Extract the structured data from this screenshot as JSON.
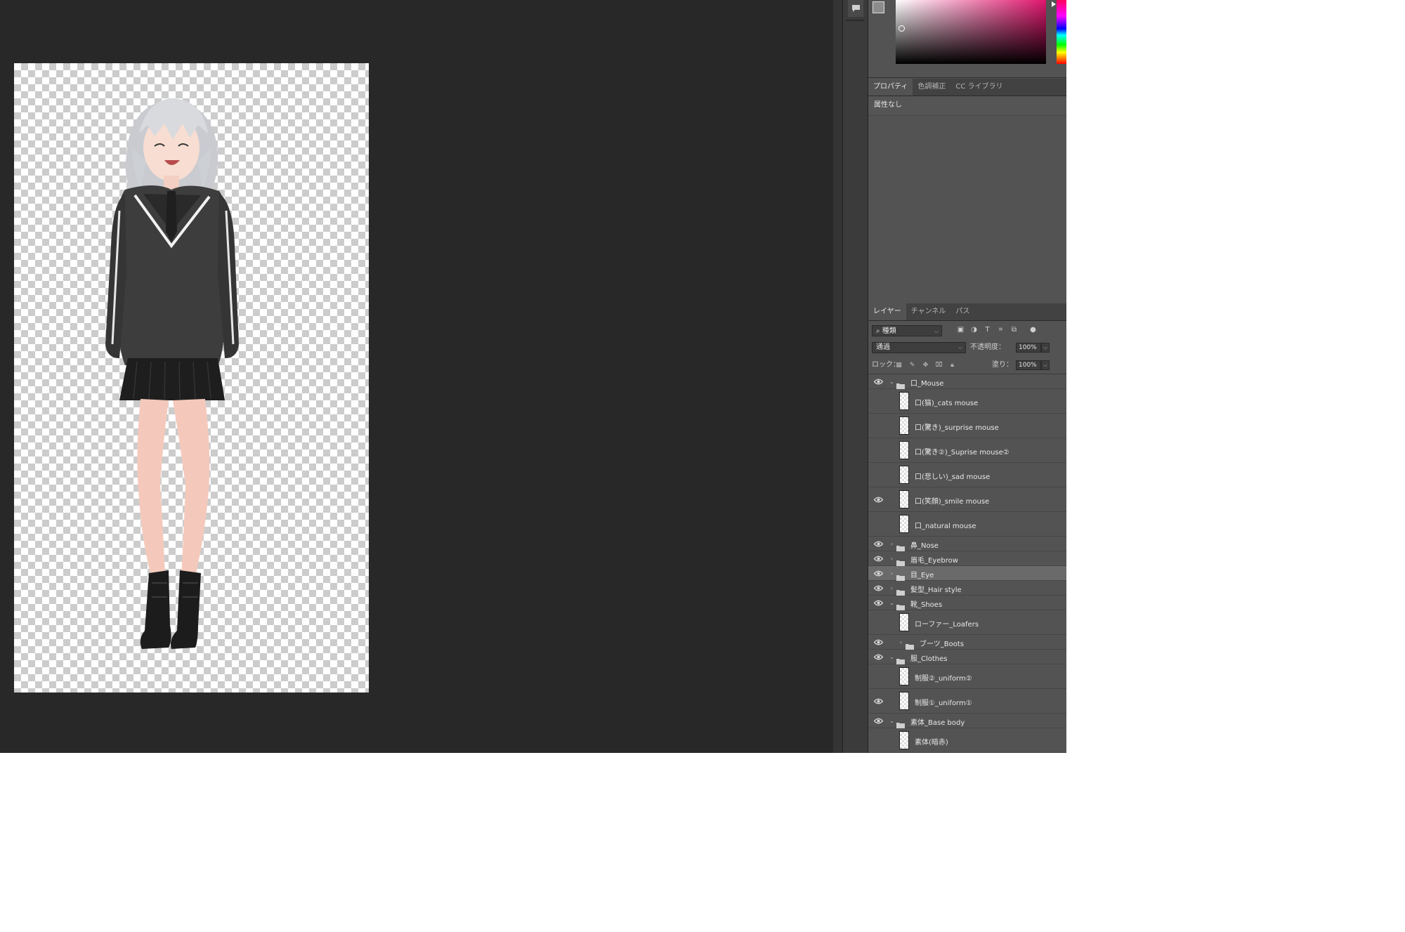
{
  "colors": {
    "workspace": "#282828",
    "panel": "#535353",
    "selected_layer": "#6a6a6a",
    "foreground_swatch": "#8b8b8b",
    "background_swatch": "#ffffff",
    "color_field_hue": "#e0166e"
  },
  "properties_panel": {
    "tabs": [
      "プロパティ",
      "色調補正",
      "CC ライブラリ"
    ],
    "active_tab": "プロパティ",
    "empty_text": "属性なし"
  },
  "layers_panel": {
    "tabs": [
      "レイヤー",
      "チャンネル",
      "パス"
    ],
    "active_tab": "レイヤー",
    "filter_kind": "種類",
    "blend_mode": "通過",
    "opacity_label": "不透明度：",
    "opacity_value": "100%",
    "lock_label": "ロック：",
    "fill_label": "塗り：",
    "fill_value": "100%",
    "filter_icons": [
      "image-filter-icon",
      "adjustment-filter-icon",
      "type-filter-icon",
      "shape-filter-icon",
      "smart-object-filter-icon",
      "filter-toggle-icon"
    ],
    "lock_icons": [
      "lock-transparent-icon",
      "lock-image-icon",
      "lock-position-icon",
      "lock-artboard-icon",
      "lock-all-icon"
    ],
    "layers": [
      {
        "name": "口_Mouse",
        "type": "group",
        "visible": true,
        "expanded": true,
        "indent": 0
      },
      {
        "name": "口(猫)_cats mouse",
        "type": "layer",
        "visible": false,
        "indent": 1
      },
      {
        "name": "口(驚き)_surprise mouse",
        "type": "layer",
        "visible": false,
        "indent": 1
      },
      {
        "name": "口(驚き②)_Suprise mouse②",
        "type": "layer",
        "visible": false,
        "indent": 1
      },
      {
        "name": "口(悲しい)_sad mouse",
        "type": "layer",
        "visible": false,
        "indent": 1
      },
      {
        "name": "口(笑顔)_smile mouse",
        "type": "layer",
        "visible": true,
        "indent": 1
      },
      {
        "name": "口_natural mouse",
        "type": "layer",
        "visible": false,
        "indent": 1
      },
      {
        "name": "鼻_Nose",
        "type": "group",
        "visible": true,
        "expanded": false,
        "indent": 0
      },
      {
        "name": "眉毛_Eyebrow",
        "type": "group",
        "visible": true,
        "expanded": false,
        "indent": 0
      },
      {
        "name": "目_Eye",
        "type": "group",
        "visible": true,
        "expanded": false,
        "indent": 0,
        "selected": true
      },
      {
        "name": "髪型_Hair style",
        "type": "group",
        "visible": true,
        "expanded": false,
        "indent": 0
      },
      {
        "name": "靴_Shoes",
        "type": "group",
        "visible": true,
        "expanded": true,
        "indent": 0
      },
      {
        "name": "ローファー_Loafers",
        "type": "layer",
        "visible": false,
        "indent": 1
      },
      {
        "name": "ブーツ_Boots",
        "type": "group",
        "visible": true,
        "expanded": false,
        "indent": 1
      },
      {
        "name": "服_Clothes",
        "type": "group",
        "visible": true,
        "expanded": true,
        "indent": 0
      },
      {
        "name": "制服②_uniform②",
        "type": "layer",
        "visible": false,
        "indent": 1
      },
      {
        "name": "制服①_uniform①",
        "type": "layer",
        "visible": true,
        "indent": 1
      },
      {
        "name": "素体_Base body",
        "type": "group",
        "visible": true,
        "expanded": true,
        "indent": 0
      },
      {
        "name": "素体(暗赤)",
        "type": "layer",
        "visible": false,
        "indent": 1
      }
    ]
  }
}
